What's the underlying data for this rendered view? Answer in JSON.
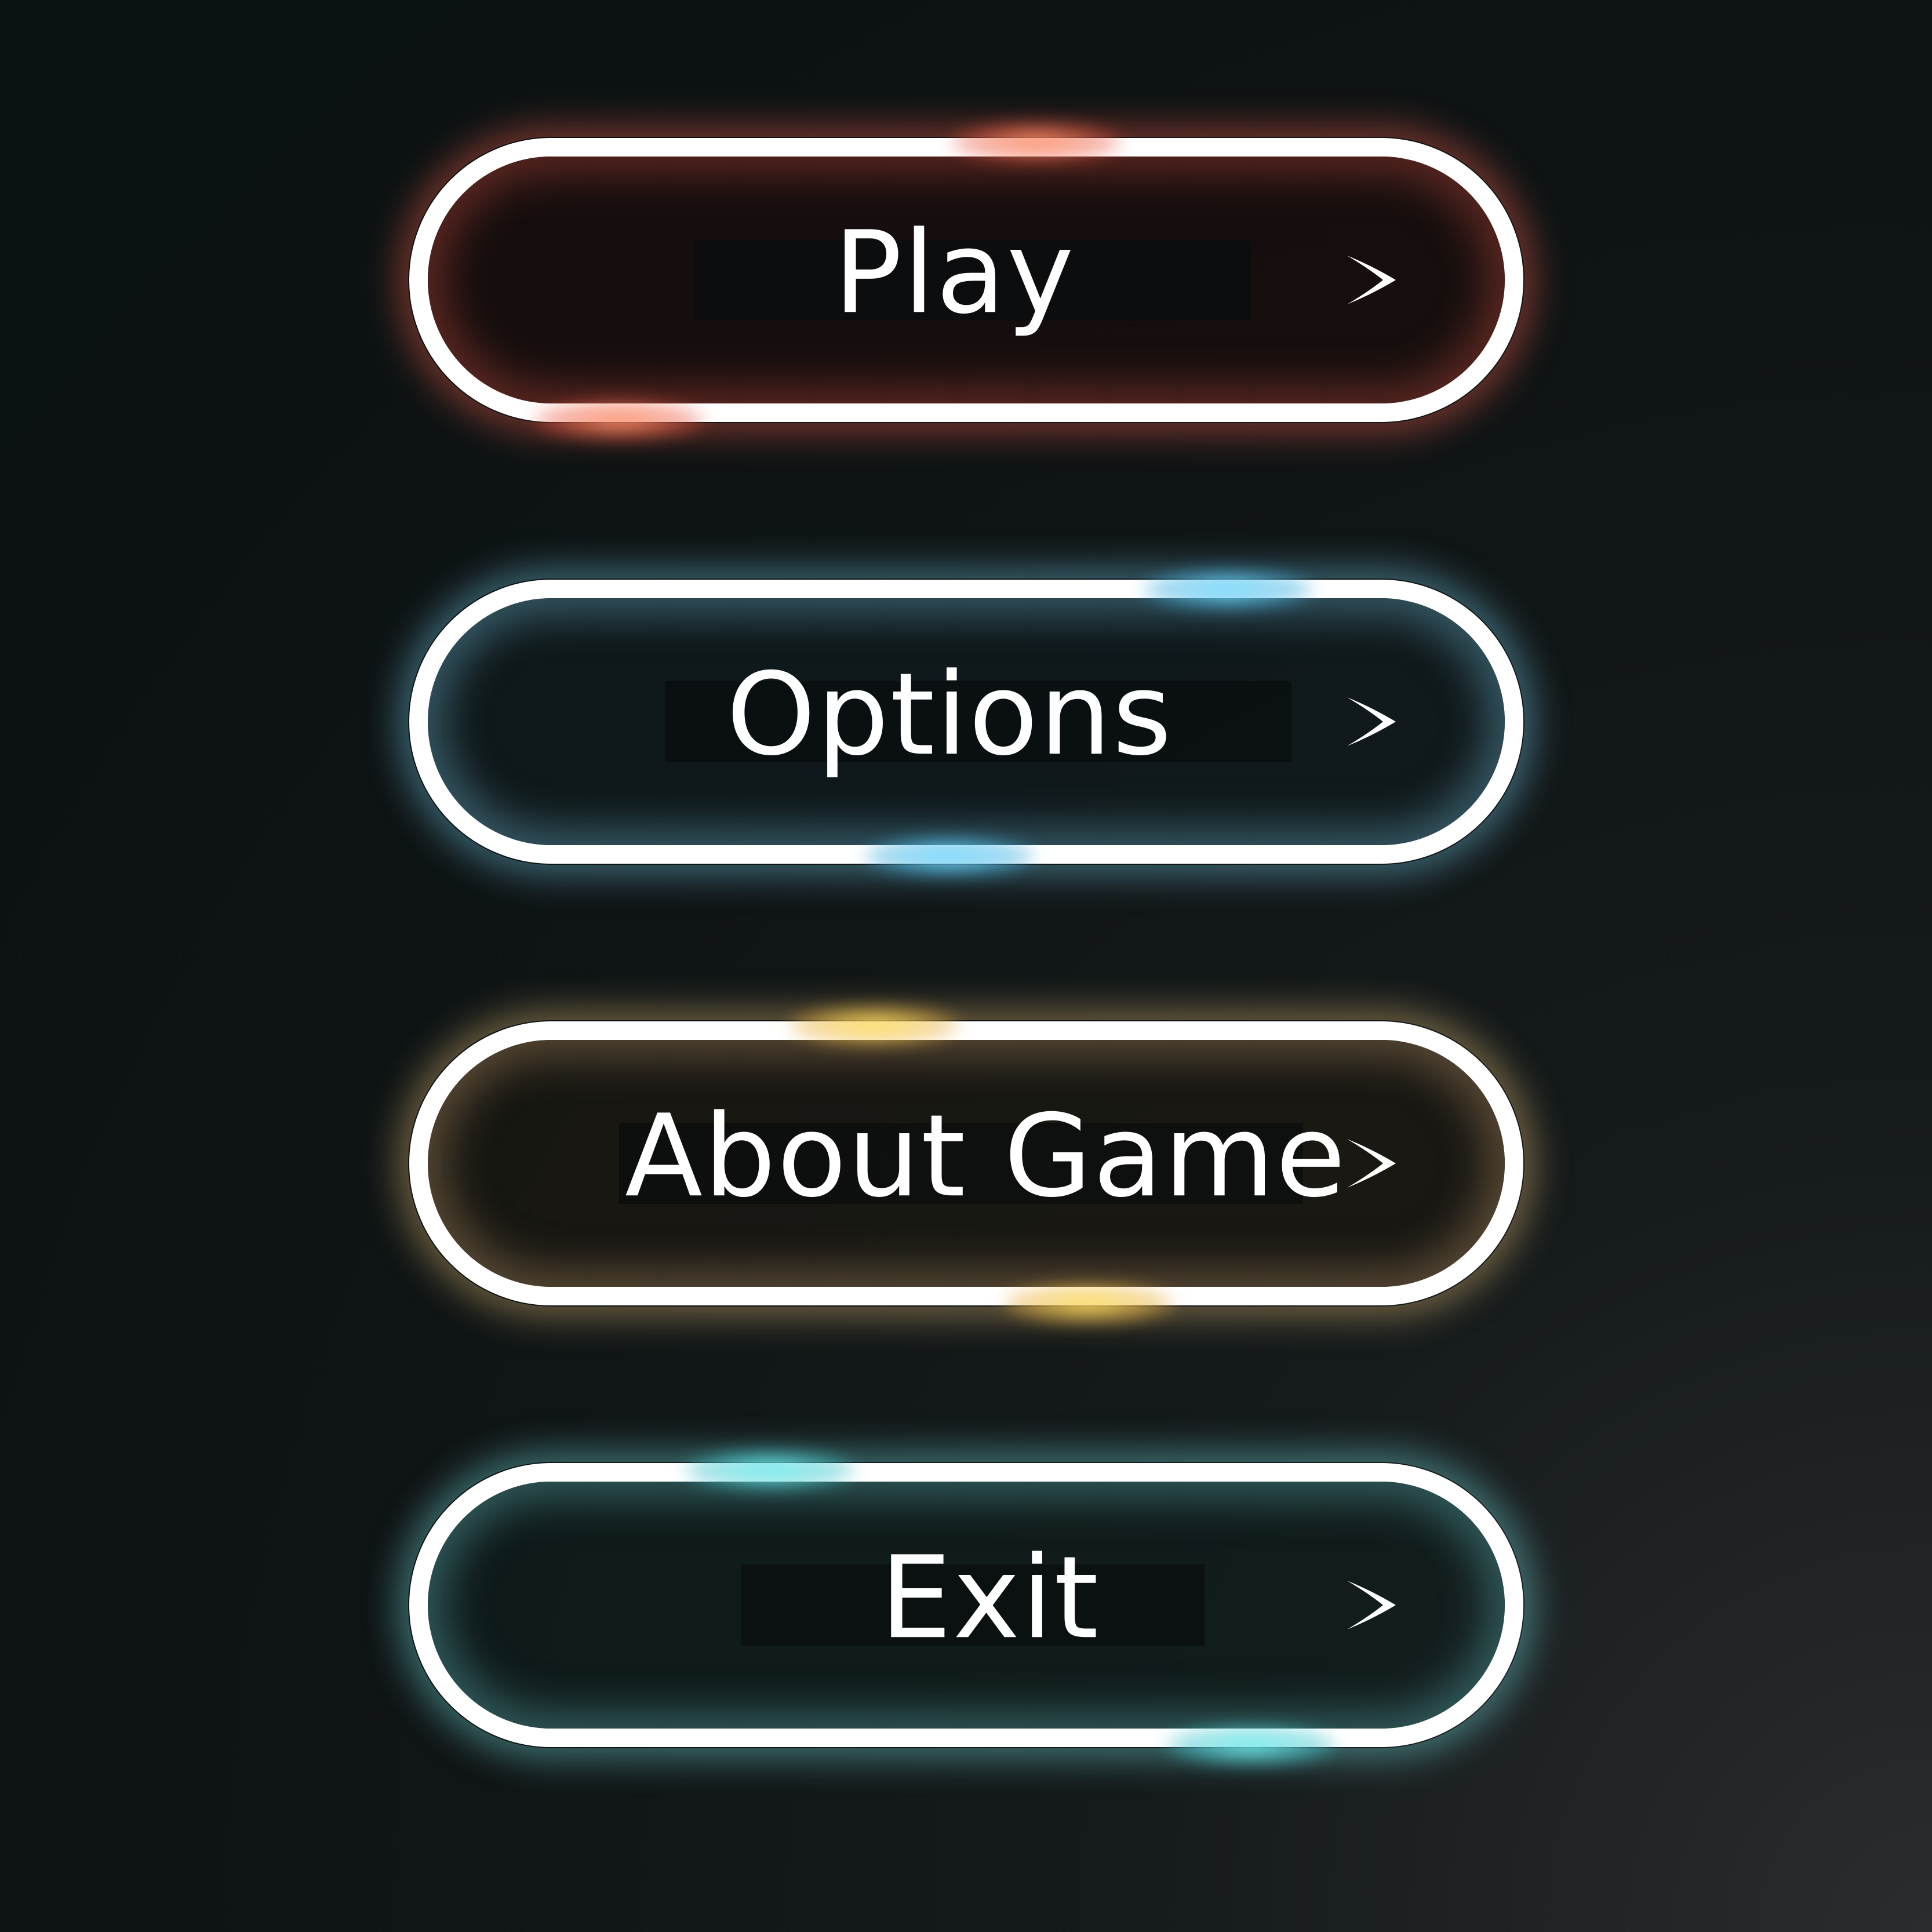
{
  "menu": {
    "buttons": [
      {
        "label": "Play",
        "glow_color": "#e65a46",
        "icon": "chevron-right-icon"
      },
      {
        "label": "Options",
        "glow_color": "#6ebedc",
        "icon": "chevron-right-icon"
      },
      {
        "label": "About Game",
        "glow_color": "#e6be78",
        "icon": "chevron-right-icon"
      },
      {
        "label": "Exit",
        "glow_color": "#6ed2d2",
        "icon": "chevron-right-icon"
      }
    ]
  },
  "colors": {
    "background": "#0f1415",
    "outline": "#ffffff",
    "text": "#ffffff"
  }
}
